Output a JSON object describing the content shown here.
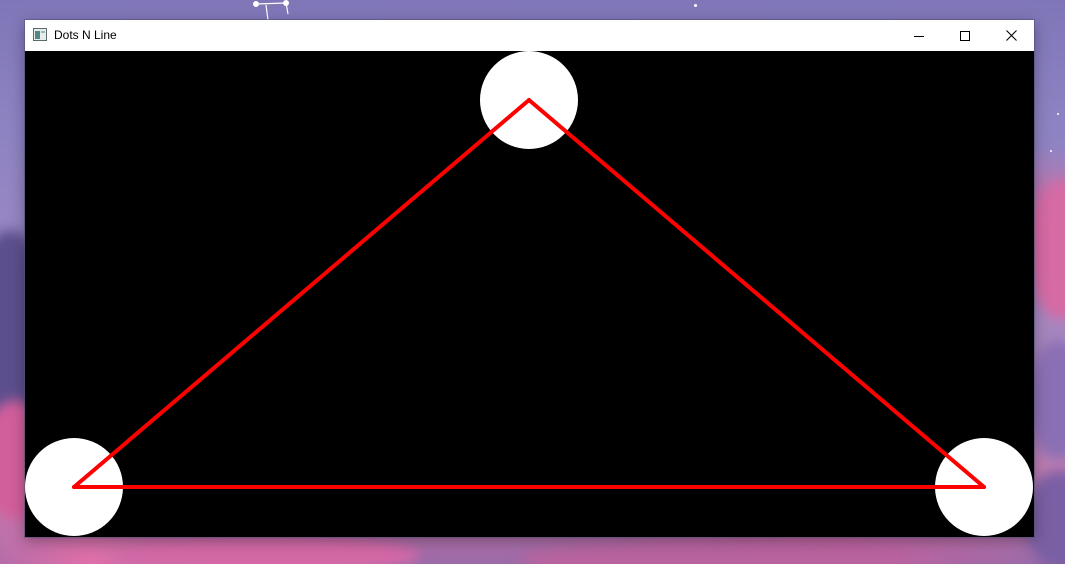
{
  "window": {
    "title": "Dots N Line",
    "app_icon": "window-app-icon",
    "controls": {
      "minimize_icon": "minimize-icon",
      "maximize_icon": "maximize-icon",
      "close_icon": "close-icon"
    }
  },
  "canvas": {
    "background_color": "#000000",
    "dot_color": "#ffffff",
    "line_color": "#ff0000",
    "dots_count": 3,
    "lines_count": 3
  },
  "desktop": {
    "wallpaper": "purple-pink-cloudy-sky"
  }
}
